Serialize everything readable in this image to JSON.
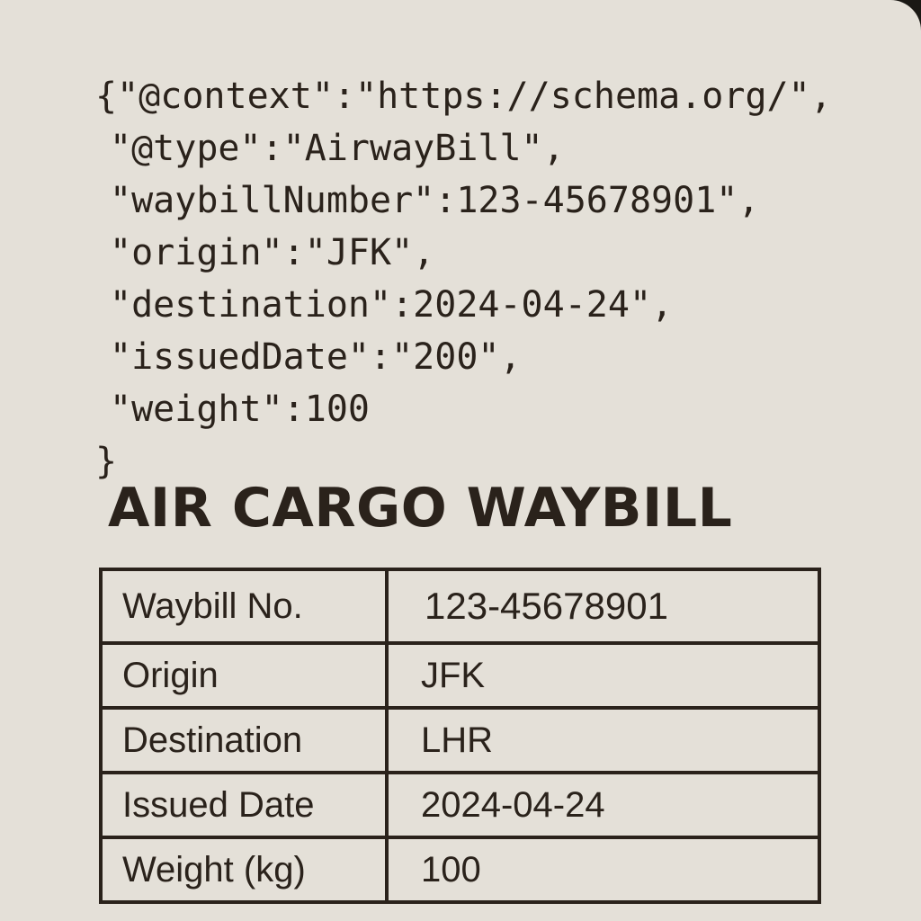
{
  "json_code": {
    "lines": [
      "{\"@context\":\"https://schema.org/\",",
      "\"@type\":\"AirwayBill\",",
      "\"waybillNumber\":123-45678901\",",
      "\"origin\":\"JFK\",",
      "\"destination\":2024-04-24\",",
      "\"issuedDate\":\"200\",",
      "\"weight\":100",
      "}"
    ]
  },
  "document": {
    "title": "AIR CARGO WAYBILL"
  },
  "table": {
    "rows": [
      {
        "label": "Waybill No.",
        "value": "123-45678901"
      },
      {
        "label": "Origin",
        "value": "JFK"
      },
      {
        "label": "Destination",
        "value": "LHR"
      },
      {
        "label": "Issued Date",
        "value": "2024-04-24"
      },
      {
        "label": "Weight (kg)",
        "value": "100"
      }
    ]
  },
  "colors": {
    "background": "#e4e0d8",
    "ink": "#2a221b"
  }
}
